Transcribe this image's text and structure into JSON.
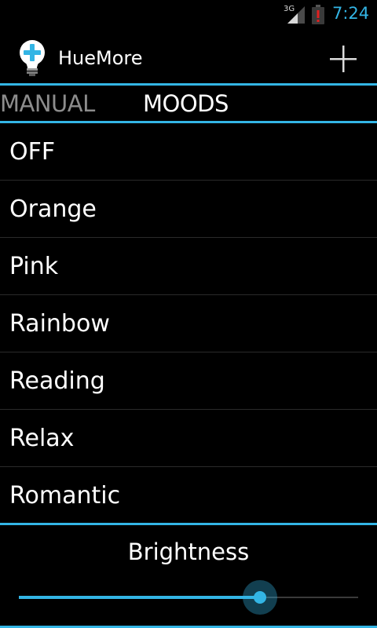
{
  "status_bar": {
    "network": "3G",
    "time": "7:24",
    "signal_icon": "signal-icon",
    "battery_icon": "battery-alert-icon",
    "accent_color": "#33b5e5"
  },
  "action_bar": {
    "app_icon": "bulb-plus-icon",
    "title": "HueMore",
    "add_icon": "plus-icon"
  },
  "tabs": [
    {
      "label": "MANUAL",
      "selected": false
    },
    {
      "label": "MOODS",
      "selected": true
    }
  ],
  "moods": [
    {
      "label": "OFF"
    },
    {
      "label": "Orange"
    },
    {
      "label": "Pink"
    },
    {
      "label": "Rainbow"
    },
    {
      "label": "Reading"
    },
    {
      "label": "Relax"
    },
    {
      "label": "Romantic"
    }
  ],
  "brightness": {
    "label": "Brightness",
    "value_fraction": 0.71
  },
  "colors": {
    "accent": "#33b5e5",
    "background": "#000000",
    "inactive_tab": "#8c8c8c"
  }
}
